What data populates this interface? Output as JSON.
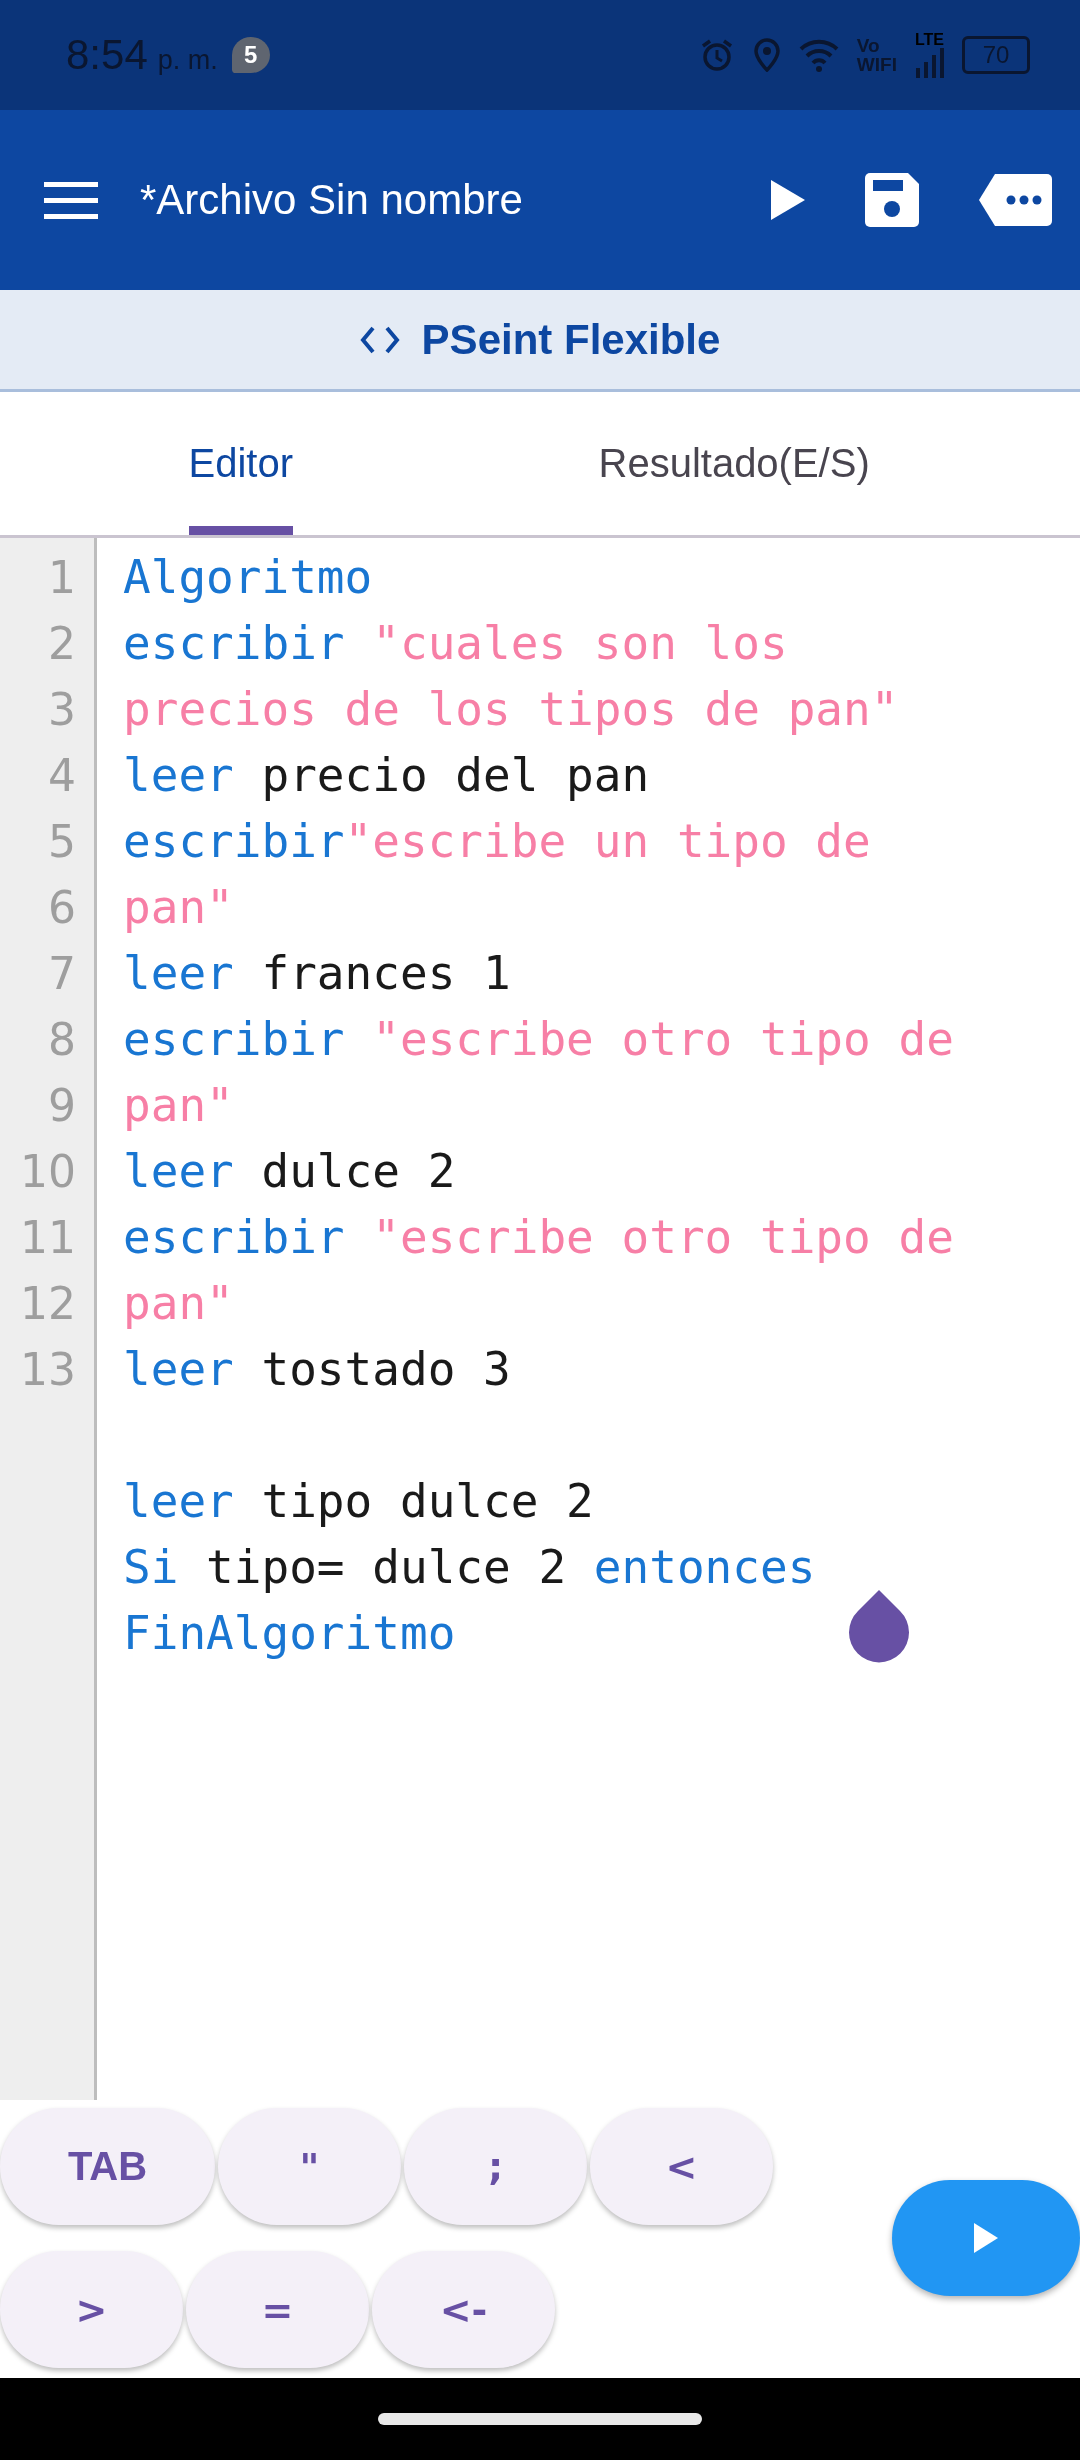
{
  "status_bar": {
    "time": "8:54",
    "meridiem": "p. m.",
    "notification_count": "5",
    "vowifi": [
      "Vo",
      "WIFI"
    ],
    "network": "LTE",
    "battery": "70"
  },
  "toolbar": {
    "title": "*Archivo Sin nombre"
  },
  "subheader": {
    "title": "PSeint Flexible"
  },
  "tabs": [
    {
      "label": "Editor",
      "selected": true
    },
    {
      "label": "Resultado(E/S)",
      "selected": false
    }
  ],
  "editor": {
    "lines": [
      {
        "kind": "code",
        "number": "1",
        "tokens": [
          {
            "kind": "keyword",
            "text": "Algoritmo"
          }
        ]
      },
      {
        "kind": "code",
        "number": "2",
        "tokens": [
          {
            "kind": "keyword",
            "text": "escribir "
          },
          {
            "kind": "string",
            "text": "\"cuales son los"
          }
        ]
      },
      {
        "kind": "code",
        "number": "3",
        "tokens": [
          {
            "kind": "string",
            "text": "precios de los tipos de pan\""
          }
        ]
      },
      {
        "kind": "code",
        "number": "4",
        "tokens": [
          {
            "kind": "keyword",
            "text": "leer"
          },
          {
            "kind": "plain",
            "text": " precio del pan"
          }
        ]
      },
      {
        "kind": "code",
        "number": "5",
        "tokens": [
          {
            "kind": "keyword",
            "text": "escribir"
          },
          {
            "kind": "string",
            "text": "\"escribe un tipo de"
          }
        ]
      },
      {
        "kind": "code",
        "number": "6",
        "tokens": [
          {
            "kind": "string",
            "text": "pan\""
          }
        ]
      },
      {
        "kind": "code",
        "number": "7",
        "tokens": [
          {
            "kind": "keyword",
            "text": "leer"
          },
          {
            "kind": "plain",
            "text": " frances 1"
          }
        ]
      },
      {
        "kind": "code",
        "number": "8",
        "tokens": [
          {
            "kind": "keyword",
            "text": "escribir "
          },
          {
            "kind": "string",
            "text": "\"escribe otro tipo de"
          }
        ]
      },
      {
        "kind": "code",
        "number": "9",
        "tokens": [
          {
            "kind": "string",
            "text": "pan\""
          }
        ]
      },
      {
        "kind": "code",
        "number": "10",
        "tokens": [
          {
            "kind": "keyword",
            "text": "leer"
          },
          {
            "kind": "plain",
            "text": " dulce 2"
          }
        ]
      },
      {
        "kind": "code",
        "number": "11",
        "tokens": [
          {
            "kind": "keyword",
            "text": "escribir "
          },
          {
            "kind": "string",
            "text": "\"escribe otro tipo de"
          }
        ]
      },
      {
        "kind": "code",
        "number": "12",
        "tokens": [
          {
            "kind": "string",
            "text": "pan\""
          }
        ]
      },
      {
        "kind": "code",
        "number": "13",
        "tokens": [
          {
            "kind": "keyword",
            "text": "leer"
          },
          {
            "kind": "plain",
            "text": " tostado 3"
          }
        ]
      },
      {
        "kind": "blank"
      },
      {
        "kind": "code",
        "tokens": [
          {
            "kind": "keyword",
            "text": "leer"
          },
          {
            "kind": "plain",
            "text": " tipo dulce 2"
          }
        ]
      },
      {
        "kind": "code",
        "tokens": [
          {
            "kind": "keyword",
            "text": "Si"
          },
          {
            "kind": "plain",
            "text": " tipo= dulce 2 "
          },
          {
            "kind": "keyword",
            "text": "entonces"
          }
        ]
      },
      {
        "kind": "code",
        "tokens": [
          {
            "kind": "keyword",
            "text": "FinAlgoritmo"
          }
        ]
      }
    ]
  },
  "keys": [
    [
      "TAB",
      "\"",
      ";",
      "<"
    ],
    [
      ">",
      "=",
      "<-"
    ]
  ]
}
